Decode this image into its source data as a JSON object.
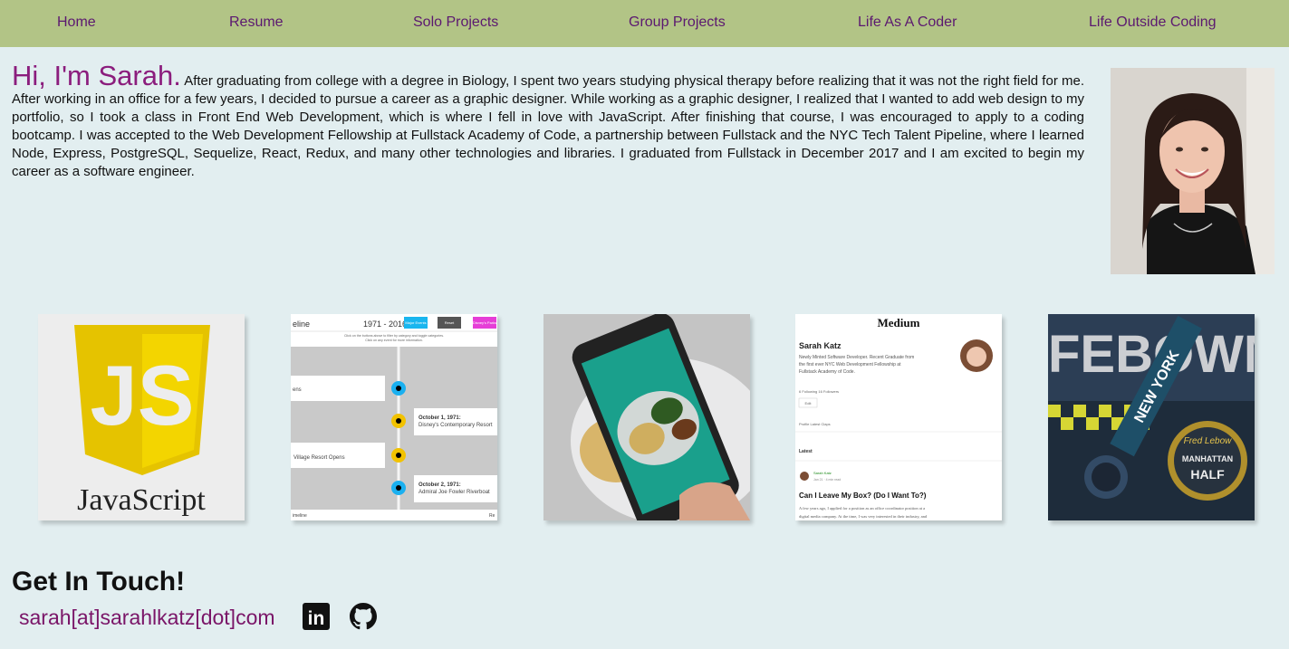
{
  "nav": {
    "items": [
      {
        "label": "Home"
      },
      {
        "label": "Resume"
      },
      {
        "label": "Solo Projects"
      },
      {
        "label": "Group Projects"
      },
      {
        "label": "Life As A Coder"
      },
      {
        "label": "Life Outside Coding"
      }
    ]
  },
  "intro": {
    "greeting": "Hi, I'm Sarah.",
    "bio": "After graduating from college with a degree in Biology, I spent two years studying physical therapy before realizing that it was not the right field for me. After working in an office for a few years, I decided to pursue a career as a graphic designer. While working as a graphic designer, I realized that I wanted to add web design to my portfolio, so I took a class in Front End Web Development, which is where I fell in love with JavaScript. After finishing that course, I was encouraged to apply to a coding bootcamp. I was accepted to the Web Development Fellowship at Fullstack Academy of Code, a partnership between Fullstack and the NYC Tech Talent Pipeline, where I learned Node, Express, PostgreSQL, Sequelize, React, Redux, and many other technologies and libraries. I graduated from Fullstack in December 2017 and I am excited to begin my career as a software engineer."
  },
  "tiles": {
    "javascript": {
      "logo_text": "JS",
      "caption": "JavaScript"
    },
    "timeline": {
      "header_left": "eline",
      "header_range": "1971 - 2016",
      "btn_blue": "Major Events",
      "btn_grey": "Reset",
      "btn_pink": "Disney's Parks",
      "instructions_1": "Click on the buttons above to filter by category and toggle categories.",
      "instructions_2": "Click on any event for more information.",
      "card_left_1": "ens",
      "card_right_1_date": "October 1, 1971:",
      "card_right_1_text": "Disney's Contemporary Resort",
      "card_left_2": "Village Resort Opens",
      "card_right_2_date": "October 2, 1971:",
      "card_right_2_text": "Admiral Joe Fowler Riverboat",
      "footer_left": "imeline",
      "footer_right": "Re"
    },
    "medium": {
      "brand": "Medium",
      "name": "Sarah Katz",
      "bio_1": "Newly Minted Software Developer. Recent Graduate from",
      "bio_2": "the first ever NYC Web Development Fellowship at",
      "bio_3": "Fullstack Academy of Code.",
      "stats": "6 Following   16 Followers",
      "edit": "Edit",
      "tabs": "Profile    Latest    Claps",
      "section": "Latest",
      "author": "Sarah Katz",
      "meta": "Jan 21 · 4 min read",
      "post_title": "Can I Leave My Box? (Do I Want To?)",
      "excerpt_1": "A few years ago, I applied for a position as an office coordinator position at a",
      "excerpt_2": "digital media company. At the time, I was very interested in their industry, and"
    },
    "medal": {
      "ribbon_text": "NEW YORK",
      "medal_top": "Fred Lebow",
      "medal_mid": "MANHATTAN",
      "medal_bottom": "HALF",
      "scarf_text": "FEBOWM"
    }
  },
  "contact": {
    "title": "Get In Touch!",
    "email": "sarah[at]sarahlkatz[dot]com",
    "linkedin_text": "in"
  },
  "colors": {
    "nav_bg": "#b2c486",
    "nav_text": "#5b1870",
    "page_bg": "#e2eef0",
    "greeting": "#8b1d7d",
    "email": "#7a1568",
    "js_yellow": "#e5c300"
  },
  "icons": [
    "linkedin-icon",
    "github-icon"
  ]
}
